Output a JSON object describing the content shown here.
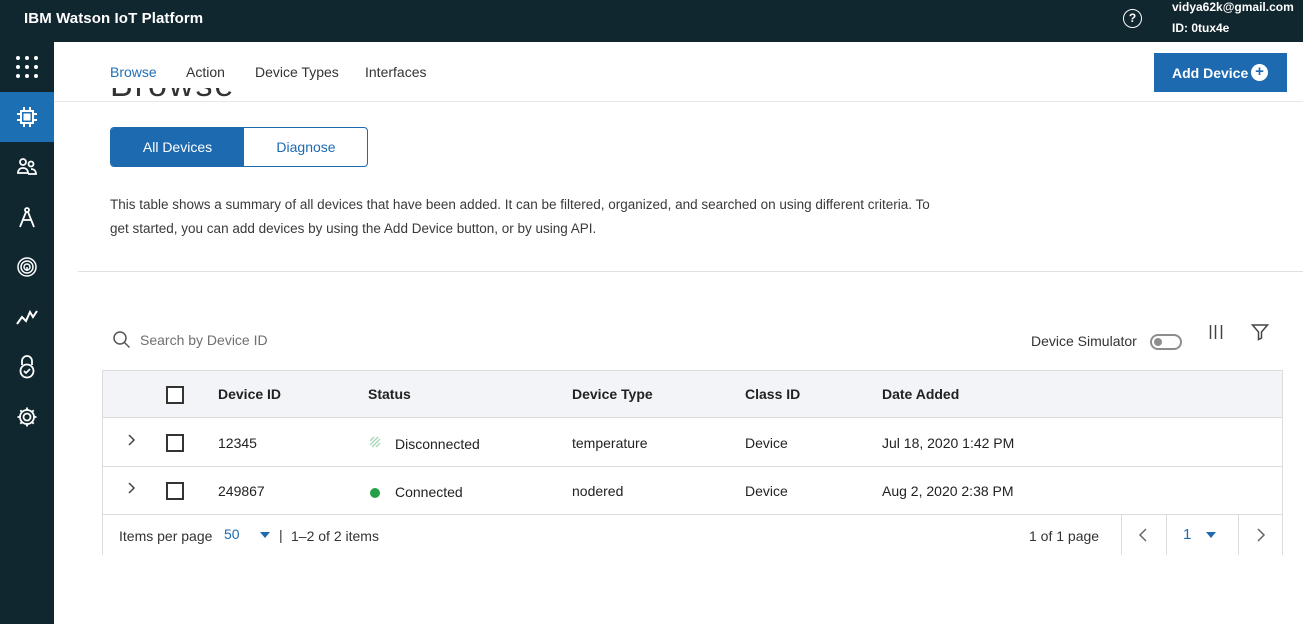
{
  "header": {
    "app_title": "IBM Watson IoT Platform",
    "help_symbol": "?",
    "user_email": "vidya62k@gmail.com",
    "user_id": "ID: 0tux4e"
  },
  "rail": {
    "items": [
      {
        "icon": "app-grid-icon"
      },
      {
        "icon": "chip-icon",
        "active": true
      },
      {
        "icon": "members-icon"
      },
      {
        "icon": "compass-icon"
      },
      {
        "icon": "fingerprint-icon"
      },
      {
        "icon": "analytics-icon"
      },
      {
        "icon": "security-lock-icon"
      },
      {
        "icon": "settings-gear-icon"
      }
    ]
  },
  "subnav": {
    "tabs": [
      {
        "label": "Browse",
        "active": true
      },
      {
        "label": "Action"
      },
      {
        "label": "Device Types"
      },
      {
        "label": "Interfaces"
      }
    ],
    "add_device_label": "Add Device",
    "add_symbol": "+"
  },
  "page": {
    "partial_title": "Browse Devices",
    "segment_all": "All Devices",
    "segment_diagnose": "Diagnose",
    "description": "This table shows a summary of all devices that have been added. It can be filtered, organized, and searched on using different criteria. To get started, you can add devices by using the Add Device button, or by using API."
  },
  "toolbar": {
    "search_placeholder": "Search by Device ID",
    "simulator_label": "Device Simulator"
  },
  "table": {
    "columns": [
      "Device ID",
      "Status",
      "Device Type",
      "Class ID",
      "Date Added"
    ],
    "rows": [
      {
        "device_id": "12345",
        "status": "Disconnected",
        "device_type": "temperature",
        "class_id": "Device",
        "date_added": "Jul 18, 2020 1:42 PM"
      },
      {
        "device_id": "249867",
        "status": "Connected",
        "device_type": "nodered",
        "class_id": "Device",
        "date_added": "Aug 2, 2020 2:38 PM"
      }
    ]
  },
  "pagination": {
    "items_per_page_label": "Items per page",
    "items_per_page_value": "50",
    "separator": "|",
    "range_text": "1–2 of 2 items",
    "page_info": "1 of 1 page",
    "current_page": "1"
  },
  "colors": {
    "header_bg": "#11272f",
    "primary_blue": "#1d6ab0",
    "connected_green": "#24a148"
  }
}
